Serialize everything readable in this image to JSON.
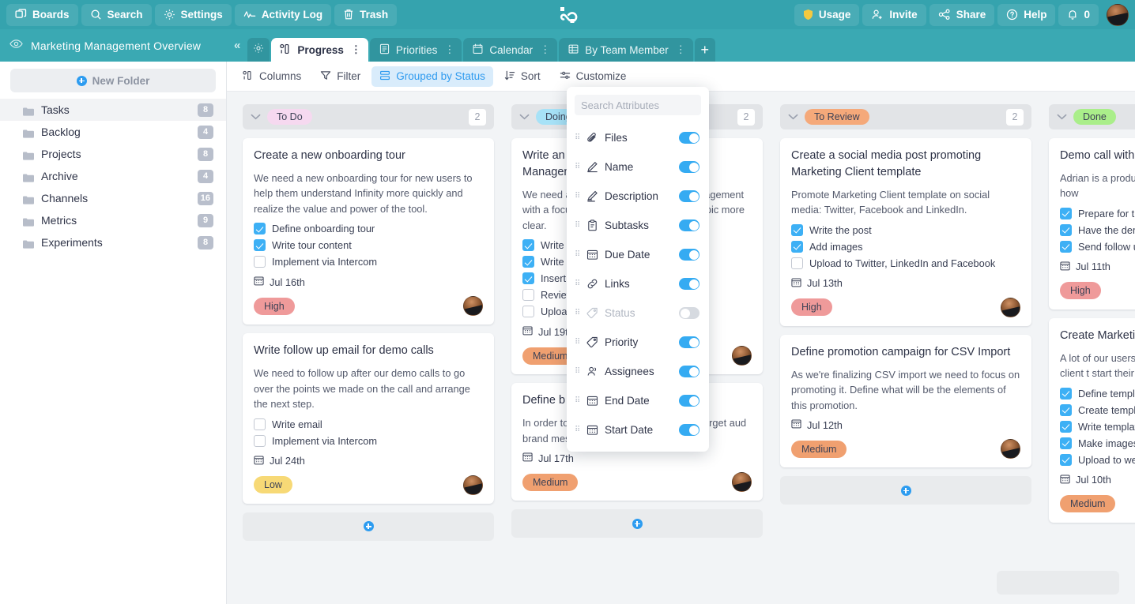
{
  "topbar": {
    "buttons": [
      {
        "label": "Boards",
        "icon": "boards-icon"
      },
      {
        "label": "Search",
        "icon": "search-icon"
      },
      {
        "label": "Settings",
        "icon": "gear-icon"
      },
      {
        "label": "Activity Log",
        "icon": "activity-icon"
      },
      {
        "label": "Trash",
        "icon": "trash-icon"
      }
    ],
    "right_buttons": [
      {
        "label": "Usage",
        "icon": "shield-icon"
      },
      {
        "label": "Invite",
        "icon": "user-add-icon"
      },
      {
        "label": "Share",
        "icon": "share-icon"
      },
      {
        "label": "Help",
        "icon": "question-circle-icon"
      },
      {
        "label": "0",
        "icon": "bell-icon"
      }
    ],
    "logo": "infinity-logo",
    "avatar": "user-avatar",
    "bg_color": "#35a3ae"
  },
  "boardbar": {
    "eye_icon": "eye-icon",
    "title": "Marketing Management Overview",
    "collapse": "«",
    "gear_icon": "gear-icon",
    "add_tab": "+",
    "tabs": [
      {
        "label": "Progress",
        "icon": "columns-icon",
        "active": true,
        "menu": "⋮"
      },
      {
        "label": "Priorities",
        "icon": "list-icon",
        "active": false,
        "menu": "⋮"
      },
      {
        "label": "Calendar",
        "icon": "calendar-icon",
        "active": false,
        "menu": "⋮"
      },
      {
        "label": "By Team Member",
        "icon": "table-icon",
        "active": false,
        "menu": "⋮"
      }
    ]
  },
  "sidebar": {
    "new_folder_label": "New Folder",
    "items": [
      {
        "label": "Tasks",
        "count": "8",
        "active": true
      },
      {
        "label": "Backlog",
        "count": "4",
        "active": false
      },
      {
        "label": "Projects",
        "count": "8",
        "active": false
      },
      {
        "label": "Archive",
        "count": "4",
        "active": false
      },
      {
        "label": "Channels",
        "count": "16",
        "active": false
      },
      {
        "label": "Metrics",
        "count": "9",
        "active": false
      },
      {
        "label": "Experiments",
        "count": "8",
        "active": false
      }
    ]
  },
  "toolbar": {
    "items": [
      {
        "label": "Columns",
        "icon": "columns-icon",
        "active": false
      },
      {
        "label": "Filter",
        "icon": "filter-icon",
        "active": false
      },
      {
        "label": "Grouped by Status",
        "icon": "group-icon",
        "active": true
      },
      {
        "label": "Sort",
        "icon": "sort-icon",
        "active": false
      },
      {
        "label": "Customize",
        "icon": "customize-icon",
        "active": false
      }
    ]
  },
  "attributes_panel": {
    "search_placeholder": "Search Attributes",
    "search_value": "",
    "rows": [
      {
        "label": "Files",
        "icon": "paperclip-icon",
        "on": true
      },
      {
        "label": "Name",
        "icon": "pencil-icon",
        "on": true
      },
      {
        "label": "Description",
        "icon": "pencil-lines-icon",
        "on": true
      },
      {
        "label": "Subtasks",
        "icon": "clipboard-icon",
        "on": true
      },
      {
        "label": "Due Date",
        "icon": "calendar-icon",
        "on": true
      },
      {
        "label": "Links",
        "icon": "link-icon",
        "on": true
      },
      {
        "label": "Status",
        "icon": "tag-icon",
        "on": false
      },
      {
        "label": "Priority",
        "icon": "tag-icon",
        "on": true
      },
      {
        "label": "Assignees",
        "icon": "people-icon",
        "on": true
      },
      {
        "label": "End Date",
        "icon": "calendar-icon",
        "on": true
      },
      {
        "label": "Start Date",
        "icon": "calendar-icon",
        "on": true
      }
    ]
  },
  "board": {
    "add_card_label": "+",
    "columns": [
      {
        "status": "To Do",
        "status_color": "#f6d9f0",
        "count": "2",
        "cards": [
          {
            "title": "Create a new onboarding tour",
            "description": "We need a new onboarding tour for new users to help them understand Infinity more quickly and realize the value and power of the tool.",
            "subtasks": [
              {
                "label": "Define onboarding tour",
                "done": true
              },
              {
                "label": "Write tour content",
                "done": true
              },
              {
                "label": "Implement via Intercom",
                "done": false
              }
            ],
            "date": "Jul 16th",
            "priority": "High",
            "priority_color": "#ef9a9a"
          },
          {
            "title": "Write follow up email for demo calls",
            "description": "We need to follow up after our demo calls to go over the points we made on the call and arrange the next step.",
            "subtasks": [
              {
                "label": "Write email",
                "done": false
              },
              {
                "label": "Implement via Intercom",
                "done": false
              }
            ],
            "date": "Jul 24th",
            "priority": "Low",
            "priority_color": "#f7d976"
          }
        ]
      },
      {
        "status": "Doing",
        "status_color": "#a7e2f7",
        "count": "2",
        "cards": [
          {
            "title": "Write an article about Marketing Management",
            "description": "We need an article about marketing management with a focus on Marketing to make this topic more clear.",
            "subtasks": [
              {
                "label": "Write t",
                "done": true
              },
              {
                "label": "Write t",
                "done": true
              },
              {
                "label": "Insert",
                "done": true
              },
              {
                "label": "Review",
                "done": false
              },
              {
                "label": "Upload",
                "done": false
              }
            ],
            "date": "Jul 19th",
            "priority": "Medium",
            "priority_color": "#f0a070"
          },
          {
            "title": "Define b",
            "description": "In order to market and always co to our target aud brand messaging.",
            "subtasks": [],
            "date": "Jul 17th",
            "priority": "Medium",
            "priority_color": "#f0a070"
          }
        ]
      },
      {
        "status": "To Review",
        "status_color": "#f5a97a",
        "count": "2",
        "cards": [
          {
            "title": "Create a social media post promoting Marketing Client template",
            "description": "Promote Marketing Client template on social media: Twitter, Facebook and LinkedIn.",
            "subtasks": [
              {
                "label": "Write the post",
                "done": true
              },
              {
                "label": "Add images",
                "done": true
              },
              {
                "label": "Upload to Twitter, LinkedIn and Facebook",
                "done": false
              }
            ],
            "date": "Jul 13th",
            "priority": "High",
            "priority_color": "#ef9a9a"
          },
          {
            "title": "Define promotion campaign for CSV Import",
            "description": "As we're finalizing CSV import we need to focus on promoting it. Define what will be the elements of this promotion.",
            "subtasks": [],
            "date": "Jul 12th",
            "priority": "Medium",
            "priority_color": "#f0a070"
          }
        ]
      },
      {
        "status": "Done",
        "status_color": "#aaee8a",
        "count": "",
        "cards": [
          {
            "title": "Demo call with",
            "description": "Adrian is a produc product team. He and some tips how",
            "subtasks": [
              {
                "label": "Prepare for th",
                "done": true
              },
              {
                "label": "Have the dem",
                "done": true
              },
              {
                "label": "Send follow up",
                "done": true
              }
            ],
            "date": "Jul 11th",
            "priority": "High",
            "priority_color": "#ef9a9a"
          },
          {
            "title": "Create Marketin",
            "description": "A lot of our users niche, we need to marketing client t start their organiz",
            "subtasks": [
              {
                "label": "Define templa",
                "done": true
              },
              {
                "label": "Create templa",
                "done": true
              },
              {
                "label": "Write template",
                "done": true
              },
              {
                "label": "Make images",
                "done": true
              },
              {
                "label": "Upload to web",
                "done": true
              }
            ],
            "date": "Jul 10th",
            "priority": "Medium",
            "priority_color": "#f0a070"
          }
        ]
      }
    ]
  }
}
